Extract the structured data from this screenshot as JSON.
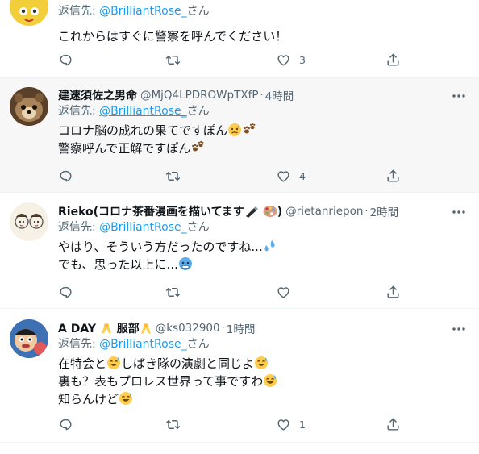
{
  "tweets": [
    {
      "reply_prefix": "返信先:",
      "reply_to": "@BrilliantRose_",
      "reply_suffix": "さん",
      "lines": [
        "これからはすぐに警察を呼んでください！"
      ],
      "likes": "3"
    },
    {
      "display_name": "建速須佐之男命",
      "handle": "@MjQ4LPDROWpTXfP",
      "dot": "·",
      "time": "4時間",
      "reply_prefix": "返信先:",
      "reply_to": "@BrilliantRose_",
      "reply_suffix": "さん",
      "lines": [
        "コロナ脳の成れの果てですぽん",
        "警察呼んで正解ですぽん"
      ],
      "likes": "4"
    },
    {
      "display_name": "Rieko(コロナ茶番漫画を描いてます",
      "display_name_end": ")",
      "handle": "@rietanriepon",
      "dot": "·",
      "time": "2時間",
      "reply_prefix": "返信先:",
      "reply_to": "@BrilliantRose_",
      "reply_suffix": "さん",
      "lines": [
        "やはり、そういう方だったのですね...",
        "でも、思った以上に..."
      ],
      "likes": ""
    },
    {
      "display_name": "A DAY",
      "display_name_2": "服部",
      "handle": "@ks032900",
      "dot": "·",
      "time": "1時間",
      "reply_prefix": "返信先:",
      "reply_to": "@BrilliantRose_",
      "reply_suffix": "さん",
      "lines": [
        "在特会と",
        "しばき隊の演劇と同じよ",
        "裏も？表もプロレス世界って事ですわ",
        "知らんけど"
      ],
      "likes": "1"
    }
  ],
  "colors": {
    "link": "#1d9bf0",
    "secondary": "#536471",
    "hover_bg": "#f7f7f7",
    "divider": "#eff3f4"
  },
  "icons": [
    "reply-icon",
    "retweet-icon",
    "like-icon",
    "share-icon",
    "more-icon"
  ]
}
